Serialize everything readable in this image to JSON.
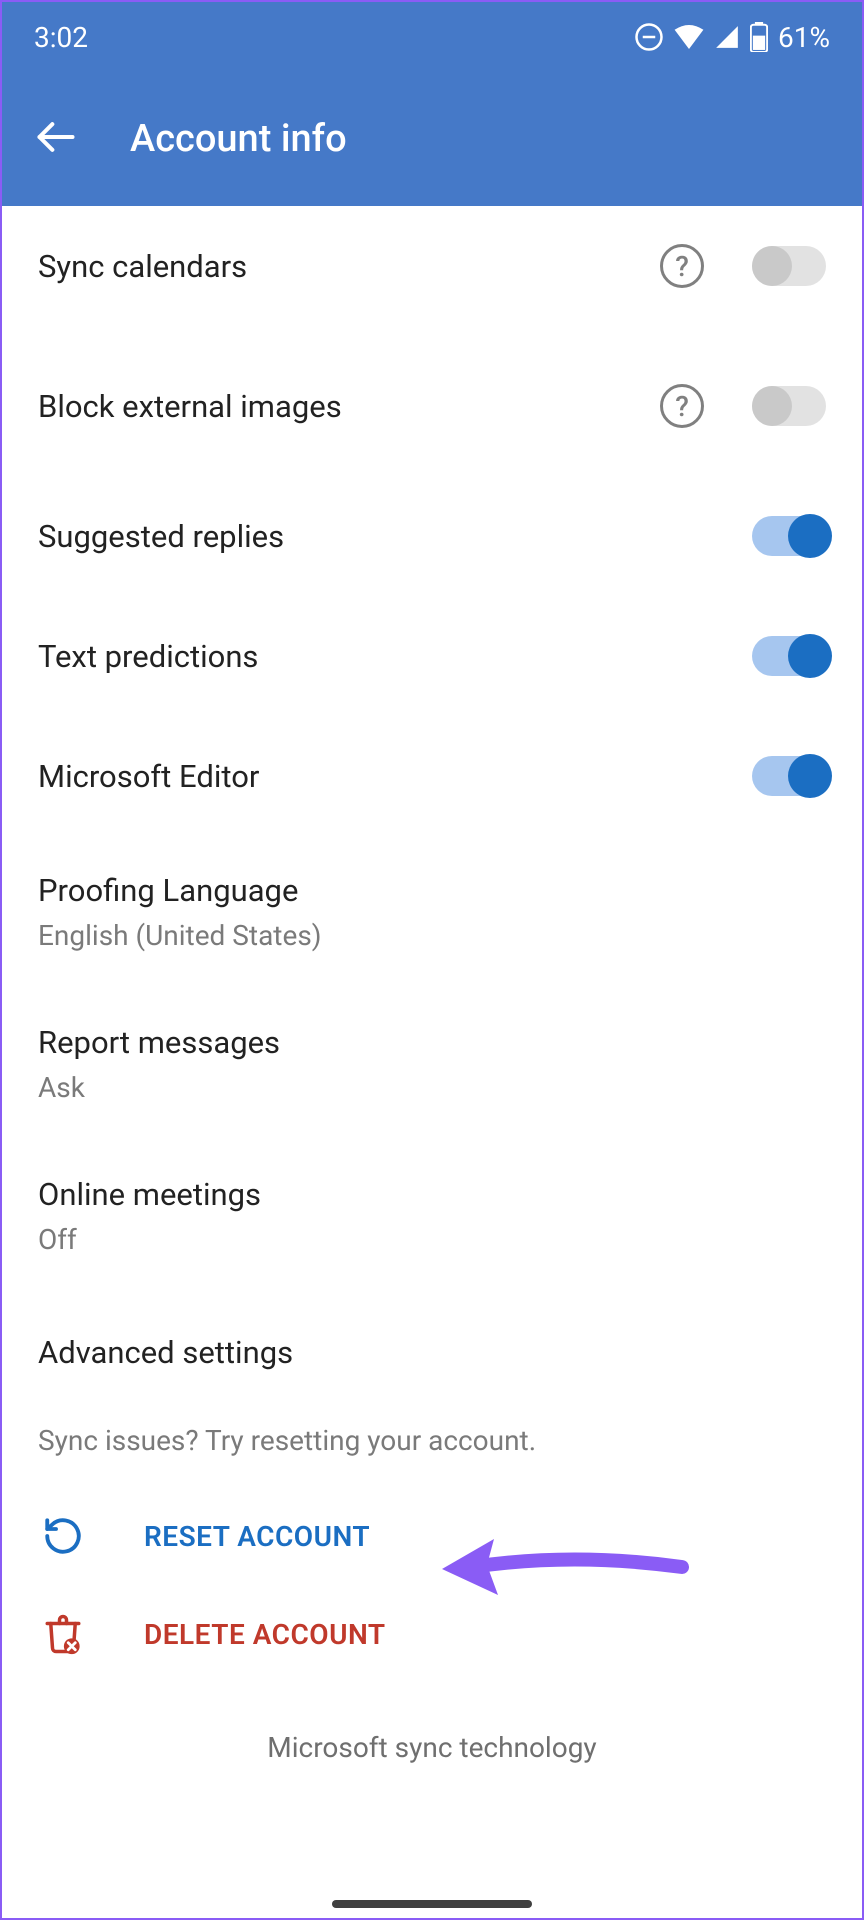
{
  "statusbar": {
    "time": "3:02",
    "battery_pct": "61%"
  },
  "appbar": {
    "title": "Account info"
  },
  "settings": {
    "sync_calendars": {
      "label": "Sync calendars",
      "on": false,
      "has_help": true
    },
    "block_external_images": {
      "label": "Block external images",
      "on": false,
      "has_help": true
    },
    "suggested_replies": {
      "label": "Suggested replies",
      "on": true
    },
    "text_predictions": {
      "label": "Text predictions",
      "on": true
    },
    "microsoft_editor": {
      "label": "Microsoft Editor",
      "on": true
    },
    "proofing_language": {
      "label": "Proofing Language",
      "sub": "English (United States)"
    },
    "report_messages": {
      "label": "Report messages",
      "sub": "Ask"
    },
    "online_meetings": {
      "label": "Online meetings",
      "sub": "Off"
    },
    "advanced_settings": {
      "label": "Advanced settings"
    }
  },
  "helper": "Sync issues? Try resetting your account.",
  "actions": {
    "reset": "RESET ACCOUNT",
    "delete": "DELETE ACCOUNT"
  },
  "footer": "Microsoft sync technology"
}
